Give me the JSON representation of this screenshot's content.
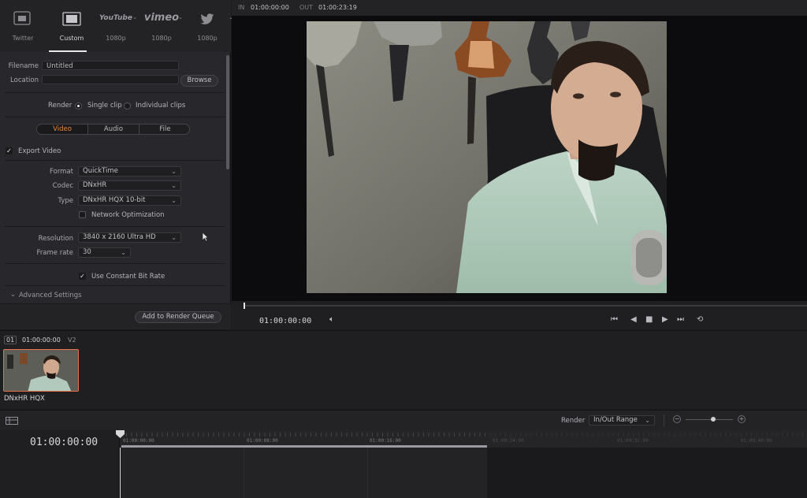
{
  "presets": [
    {
      "name": "Twitter",
      "logo": "",
      "active": false
    },
    {
      "name": "Custom",
      "logo": "",
      "active": true
    },
    {
      "name": "1080p",
      "logo": "YouTube",
      "active": false
    },
    {
      "name": "1080p",
      "logo": "vimeo",
      "active": false
    },
    {
      "name": "1080p",
      "logo": "twitter-bird",
      "active": false
    }
  ],
  "file": {
    "filename_label": "Filename",
    "filename_value": "Untitled",
    "location_label": "Location",
    "location_value": "",
    "browse_label": "Browse"
  },
  "render": {
    "label": "Render",
    "single_clip": "Single clip",
    "individual_clips": "Individual clips",
    "selected": "single_clip"
  },
  "tabs": [
    {
      "label": "Video",
      "active": true
    },
    {
      "label": "Audio",
      "active": false
    },
    {
      "label": "File",
      "active": false
    }
  ],
  "video": {
    "export_video_label": "Export Video",
    "export_video_checked": true,
    "format_label": "Format",
    "format_value": "QuickTime",
    "codec_label": "Codec",
    "codec_value": "DNxHR",
    "type_label": "Type",
    "type_value": "DNxHR HQX 10-bit",
    "network_optimization_label": "Network Optimization",
    "network_optimization_checked": false,
    "resolution_label": "Resolution",
    "resolution_value": "3840 x 2160 Ultra HD",
    "framerate_label": "Frame rate",
    "framerate_value": "30",
    "constant_bitrate_label": "Use Constant Bit Rate",
    "constant_bitrate_checked": true,
    "advanced_label": "Advanced Settings"
  },
  "add_to_queue_label": "Add to Render Queue",
  "viewer": {
    "in_label": "IN",
    "in_tc": "01:00:00:00",
    "out_label": "OUT",
    "out_tc": "01:00:23:19",
    "current_tc": "01:00:00:00"
  },
  "bin": {
    "track_number": "01",
    "track_tc": "01:00:00:00",
    "track_name": "V2",
    "clip_name": "DNxHR HQX"
  },
  "timeline": {
    "render_label": "Render",
    "render_mode": "In/Out Range",
    "current_tc": "01:00:00:00",
    "ruler": [
      "01:00:00:00",
      "01:00:08:00",
      "01:00:16:00",
      "01:00:24:00",
      "01:00:32:00",
      "01:00:40:00"
    ]
  },
  "colors": {
    "accent": "#e8883e",
    "clip_border": "#e8704a",
    "panel": "#28282c",
    "background": "#1c1c1e"
  }
}
